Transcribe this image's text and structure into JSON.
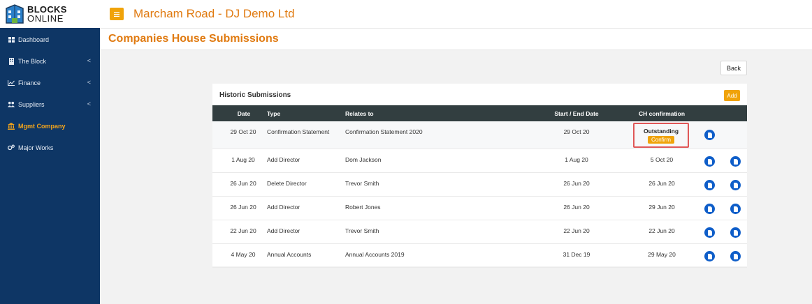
{
  "logo": {
    "line1": "BLOCKS",
    "line2": "ONLINE"
  },
  "sidebar": {
    "items": [
      {
        "label": "Dashboard",
        "icon": "grid-icon",
        "chevron": false,
        "active": false
      },
      {
        "label": "The Block",
        "icon": "building-icon",
        "chevron": true,
        "active": false
      },
      {
        "label": "Finance",
        "icon": "line-chart-icon",
        "chevron": true,
        "active": false
      },
      {
        "label": "Suppliers",
        "icon": "users-icon",
        "chevron": true,
        "active": false
      },
      {
        "label": "Mgmt Company",
        "icon": "bank-icon",
        "chevron": false,
        "active": true
      },
      {
        "label": "Major Works",
        "icon": "cogs-icon",
        "chevron": false,
        "active": false
      }
    ],
    "chevron_glyph": "<"
  },
  "header": {
    "title": "Marcham Road - DJ Demo Ltd"
  },
  "page": {
    "title": "Companies House Submissions",
    "back_label": "Back"
  },
  "panel": {
    "title": "Historic Submissions",
    "add_label": "Add",
    "columns": {
      "date": "Date",
      "type": "Type",
      "relates": "Relates to",
      "start_end": "Start / End Date",
      "ch": "CH confirmation"
    },
    "rows": [
      {
        "date": "29 Oct 20",
        "type": "Confirmation Statement",
        "relates": "Confirmation Statement 2020",
        "start_end": "29 Oct 20",
        "ch": "",
        "outstanding": "Outstanding",
        "confirm": "Confirm"
      },
      {
        "date": "1 Aug 20",
        "type": "Add Director",
        "relates": "Dom Jackson",
        "start_end": "1 Aug 20",
        "ch": "5 Oct 20"
      },
      {
        "date": "26 Jun 20",
        "type": "Delete Director",
        "relates": "Trevor Smith",
        "start_end": "26 Jun 20",
        "ch": "26 Jun 20"
      },
      {
        "date": "26 Jun 20",
        "type": "Add Director",
        "relates": "Robert Jones",
        "start_end": "26 Jun 20",
        "ch": "29 Jun 20"
      },
      {
        "date": "22 Jun 20",
        "type": "Add Director",
        "relates": "Trevor Smith",
        "start_end": "22 Jun 20",
        "ch": "22 Jun 20"
      },
      {
        "date": "4 May 20",
        "type": "Annual Accounts",
        "relates": "Annual Accounts 2019",
        "start_end": "31 Dec 19",
        "ch": "29 May 20"
      }
    ]
  },
  "colors": {
    "sidebar": "#0e3665",
    "accent": "#f0a30a",
    "title_orange": "#e07a10",
    "table_header": "#323e40",
    "doc_button": "#0f5ec9",
    "highlight": "#e05757"
  }
}
